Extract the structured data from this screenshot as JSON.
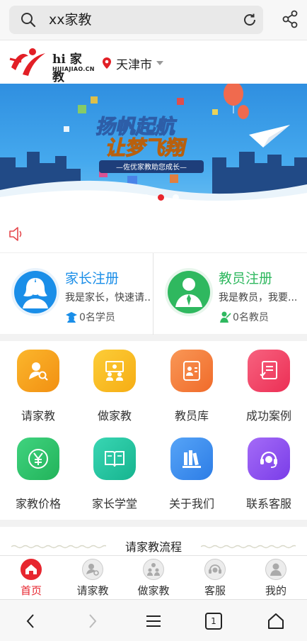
{
  "browser": {
    "search_text": "xx家教"
  },
  "header": {
    "logo_text": "hi 家教",
    "logo_domain": "HIJIAJIAO.CN",
    "city": "天津市"
  },
  "banner": {
    "headline_1": "扬帆起航",
    "headline_2": "让梦飞翔",
    "slogan": "—佐优家教助您成长—",
    "slides": 4,
    "active_slide": 3
  },
  "register": {
    "parent": {
      "title": "家长注册",
      "desc": "我是家长，快速请...",
      "count": "0名学员",
      "color": "#1a8ee8"
    },
    "tutor": {
      "title": "教员注册",
      "desc": "我是教员，我要...",
      "count": "0名教员",
      "color": "#2fb85f"
    }
  },
  "grid": [
    {
      "label": "请家教",
      "icon": "user-search-icon",
      "color": "#f7a21a"
    },
    {
      "label": "做家教",
      "icon": "teacher-icon",
      "color": "#f8bf19"
    },
    {
      "label": "教员库",
      "icon": "tutor-card-icon",
      "color": "#f5813b"
    },
    {
      "label": "成功案例",
      "icon": "case-book-icon",
      "color": "#f2466a"
    },
    {
      "label": "家教价格",
      "icon": "yen-icon",
      "color": "#2ec46c"
    },
    {
      "label": "家长学堂",
      "icon": "open-book-icon",
      "color": "#22c6a4"
    },
    {
      "label": "关于我们",
      "icon": "books-icon",
      "color": "#3b8ff0"
    },
    {
      "label": "联系客服",
      "icon": "headset-icon",
      "color": "#8a4cf0"
    }
  ],
  "process": {
    "title": "请家教流程"
  },
  "tabs": [
    {
      "label": "首页",
      "icon": "home-icon",
      "active": true
    },
    {
      "label": "请家教",
      "icon": "user-search-icon",
      "active": false
    },
    {
      "label": "做家教",
      "icon": "teacher-icon",
      "active": false
    },
    {
      "label": "客服",
      "icon": "headset-icon",
      "active": false
    },
    {
      "label": "我的",
      "icon": "user-icon",
      "active": false
    }
  ],
  "sysnav": {
    "tab_count": "1"
  },
  "colors": {
    "accent": "#e7262f",
    "parent_blue": "#1a8ee8",
    "tutor_green": "#2fb85f"
  }
}
